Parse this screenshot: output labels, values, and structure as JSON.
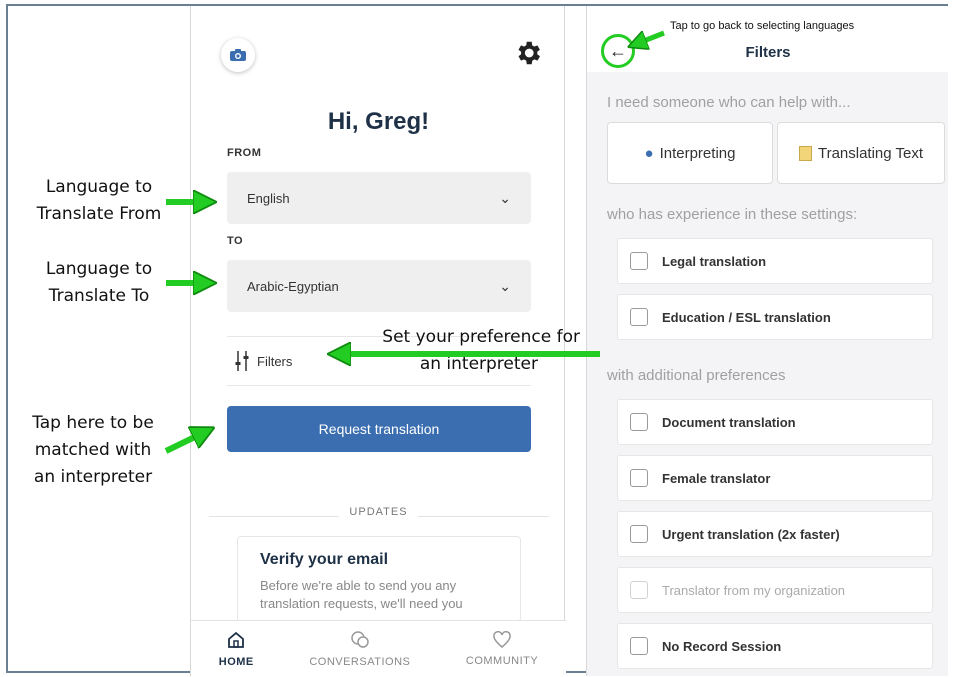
{
  "home": {
    "greeting": "Hi, Greg!",
    "from_label": "FROM",
    "from_value": "English",
    "to_label": "TO",
    "to_value": "Arabic-Egyptian",
    "filters_label": "Filters",
    "request_button": "Request translation",
    "updates_heading": "UPDATES",
    "card_title": "Verify your email",
    "card_body": "Before we're able to send you any translation requests, we'll need you",
    "tabs": [
      {
        "label": "HOME",
        "icon": "home-icon"
      },
      {
        "label": "CONVERSATIONS",
        "icon": "chat-bubbles-icon"
      },
      {
        "label": "COMMUNITY",
        "icon": "heart-icon"
      }
    ]
  },
  "filters": {
    "title": "Filters",
    "help_heading": "I need someone who can help with...",
    "chips": [
      {
        "label": "Interpreting",
        "icon": "speech-bubble-icon"
      },
      {
        "label": "Translating Text",
        "icon": "notepad-icon"
      }
    ],
    "settings_heading": "who has experience in these settings:",
    "settings": [
      {
        "label": "Legal translation"
      },
      {
        "label": "Education / ESL translation"
      }
    ],
    "prefs_heading": "with additional preferences",
    "prefs": [
      {
        "label": "Document translation",
        "enabled": true
      },
      {
        "label": "Female translator",
        "enabled": true
      },
      {
        "label": "Urgent translation (2x faster)",
        "enabled": true
      },
      {
        "label": "Translator from my organization",
        "enabled": false
      },
      {
        "label": "No Record Session",
        "enabled": true
      }
    ]
  },
  "annotations": {
    "from_note_1": "Language to",
    "from_note_2": "Translate From",
    "to_note_1": "Language to",
    "to_note_2": "Translate To",
    "filters_note_1": "Set your preference for",
    "filters_note_2": "an interpreter",
    "request_note_1": "Tap here to be",
    "request_note_2": "matched with",
    "request_note_3": "an interpreter",
    "back_note": "Tap to go back to selecting languages"
  },
  "colors": {
    "accent_blue": "#3b6eb0",
    "arrow_green": "#22cc22",
    "heading_navy": "#1e3147"
  }
}
